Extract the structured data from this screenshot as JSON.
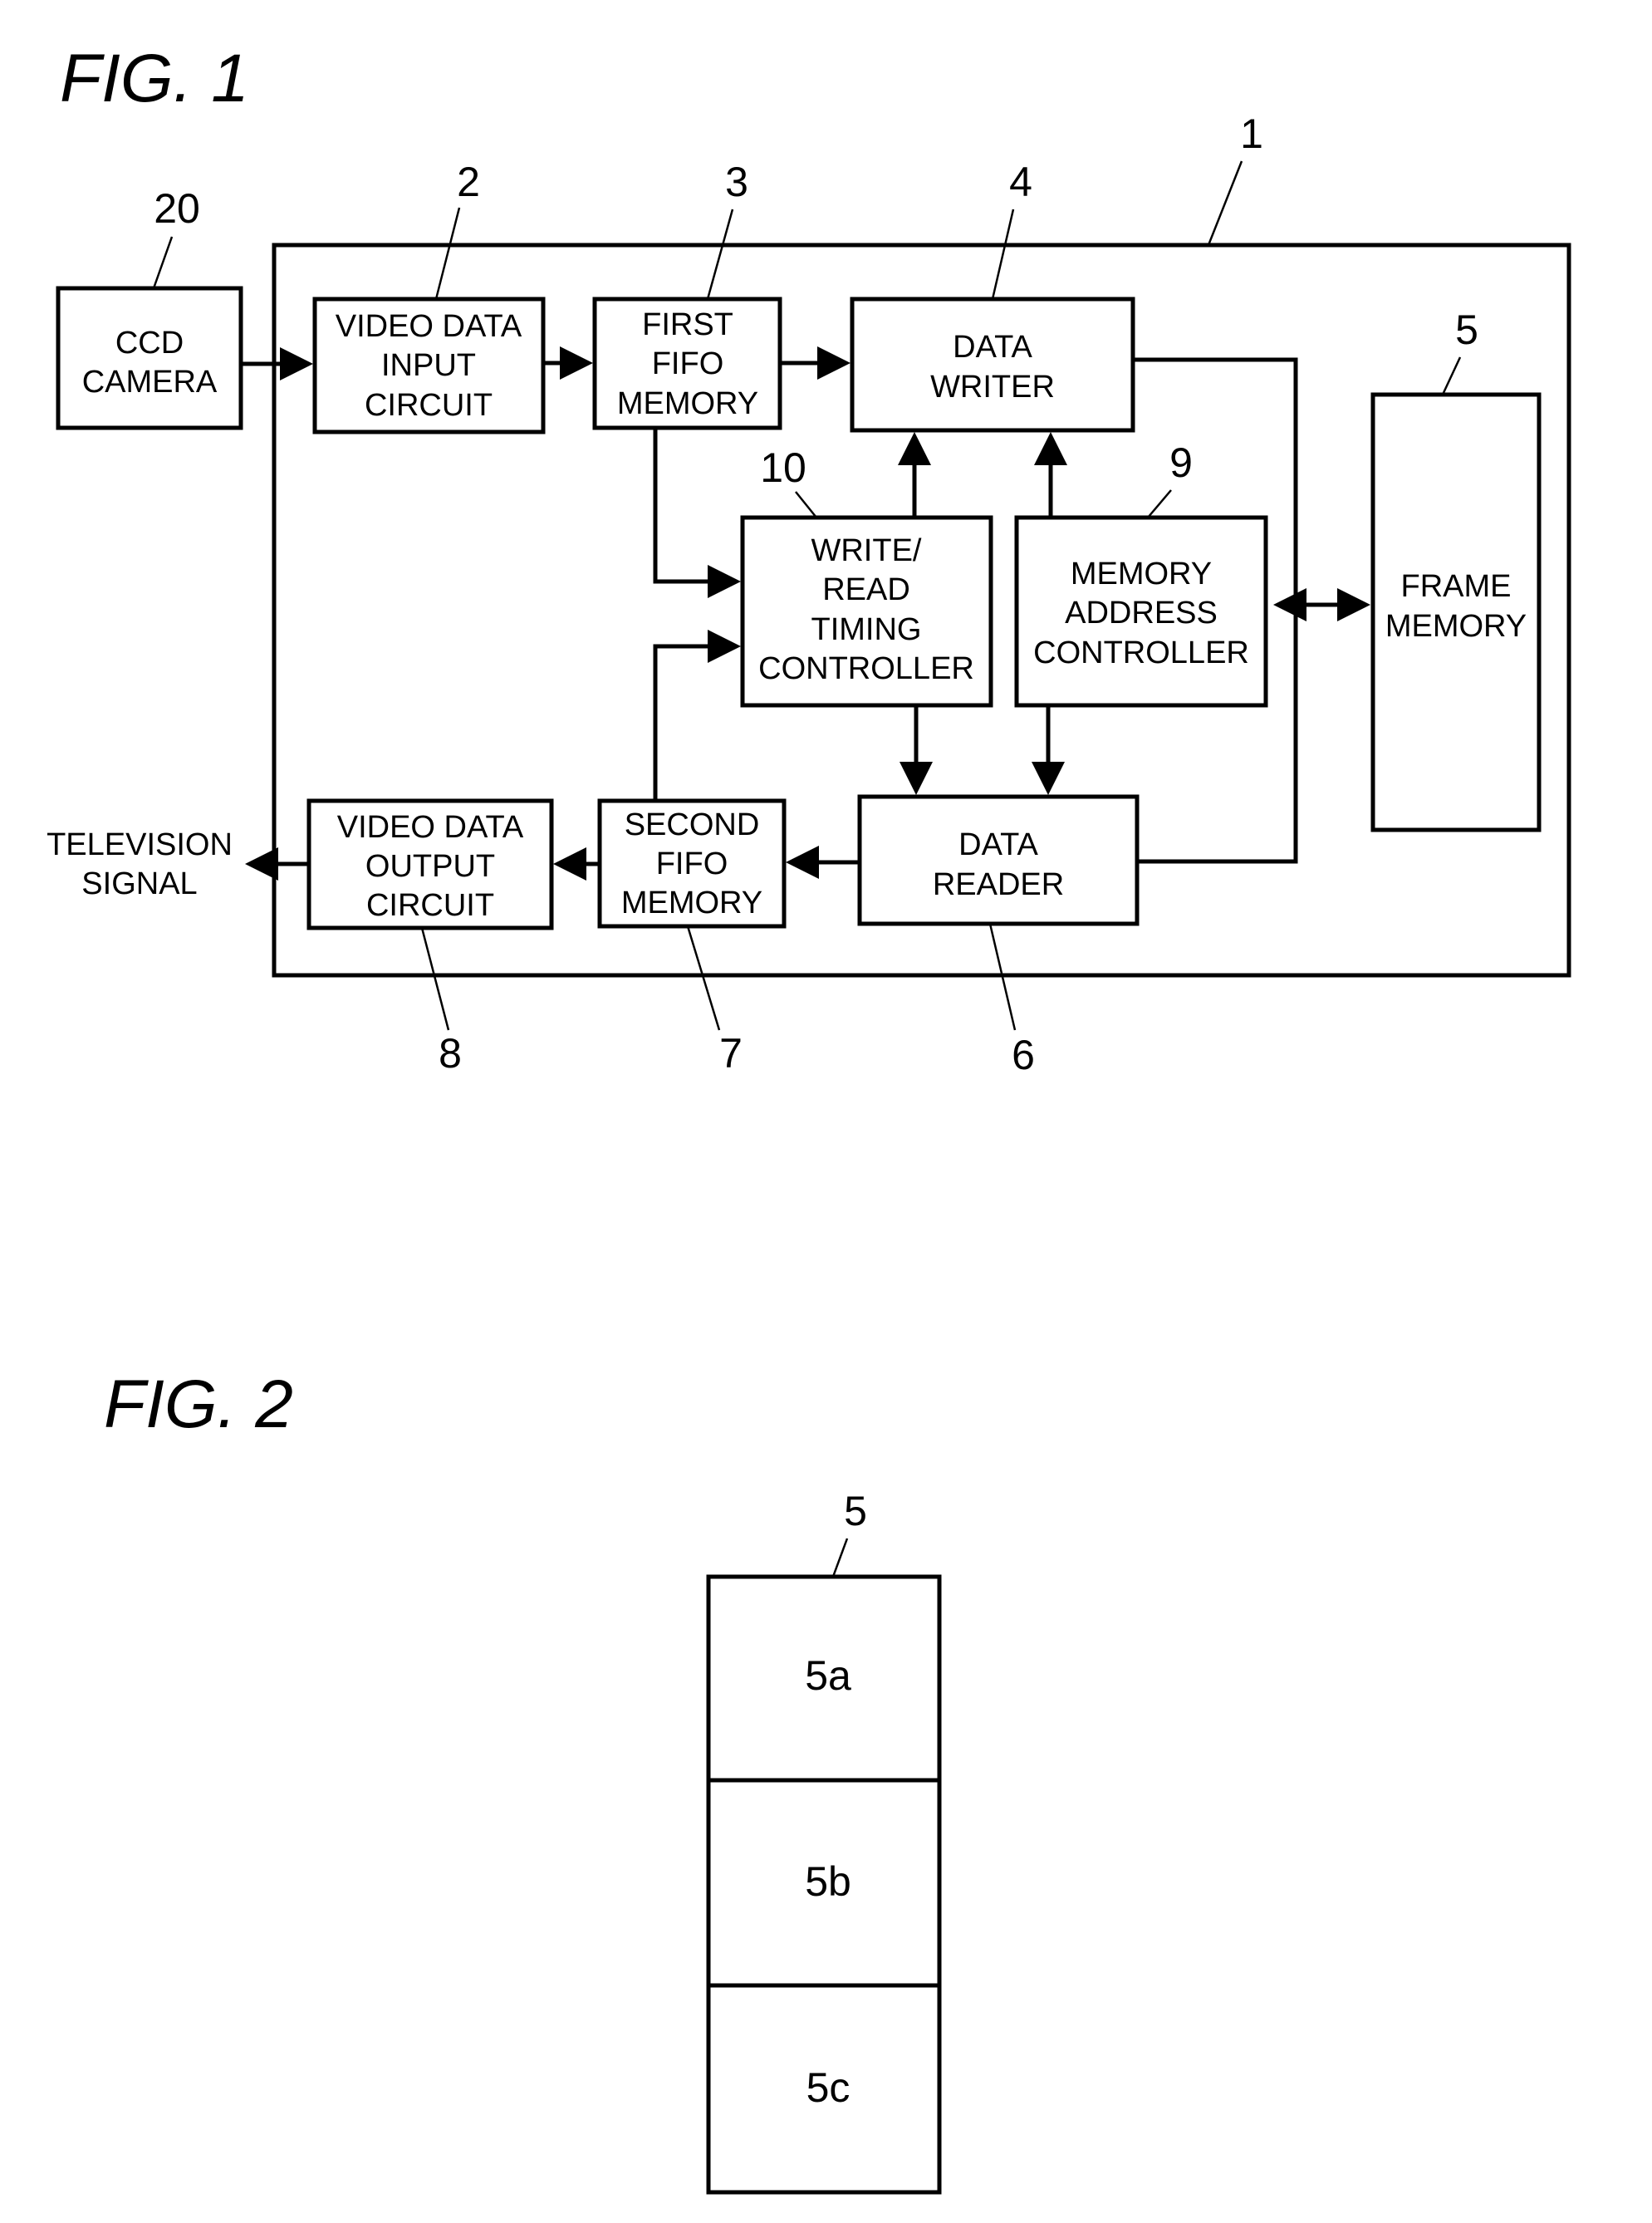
{
  "fig1": {
    "title": "FIG. 1",
    "refs": {
      "r1": "1",
      "r2": "2",
      "r3": "3",
      "r4": "4",
      "r5": "5",
      "r6": "6",
      "r7": "7",
      "r8": "8",
      "r9": "9",
      "r10": "10",
      "r20": "20"
    },
    "blocks": {
      "ccd": [
        "CCD",
        "CAMERA"
      ],
      "video_in": [
        "VIDEO DATA",
        "INPUT",
        "CIRCUIT"
      ],
      "fifo1": [
        "FIRST",
        "FIFO",
        "MEMORY"
      ],
      "writer": [
        "DATA",
        "WRITER"
      ],
      "timing": [
        "WRITE/",
        "READ",
        "TIMING",
        "CONTROLLER"
      ],
      "addr": [
        "MEMORY",
        "ADDRESS",
        "CONTROLLER"
      ],
      "frame": [
        "FRAME",
        "MEMORY"
      ],
      "reader": [
        "DATA",
        "READER"
      ],
      "fifo2": [
        "SECOND",
        "FIFO",
        "MEMORY"
      ],
      "video_out": [
        "VIDEO DATA",
        "OUTPUT",
        "CIRCUIT"
      ]
    },
    "output_label": [
      "TELEVISION",
      "SIGNAL"
    ]
  },
  "fig2": {
    "title": "FIG. 2",
    "ref": "5",
    "sections": [
      "5a",
      "5b",
      "5c"
    ]
  }
}
